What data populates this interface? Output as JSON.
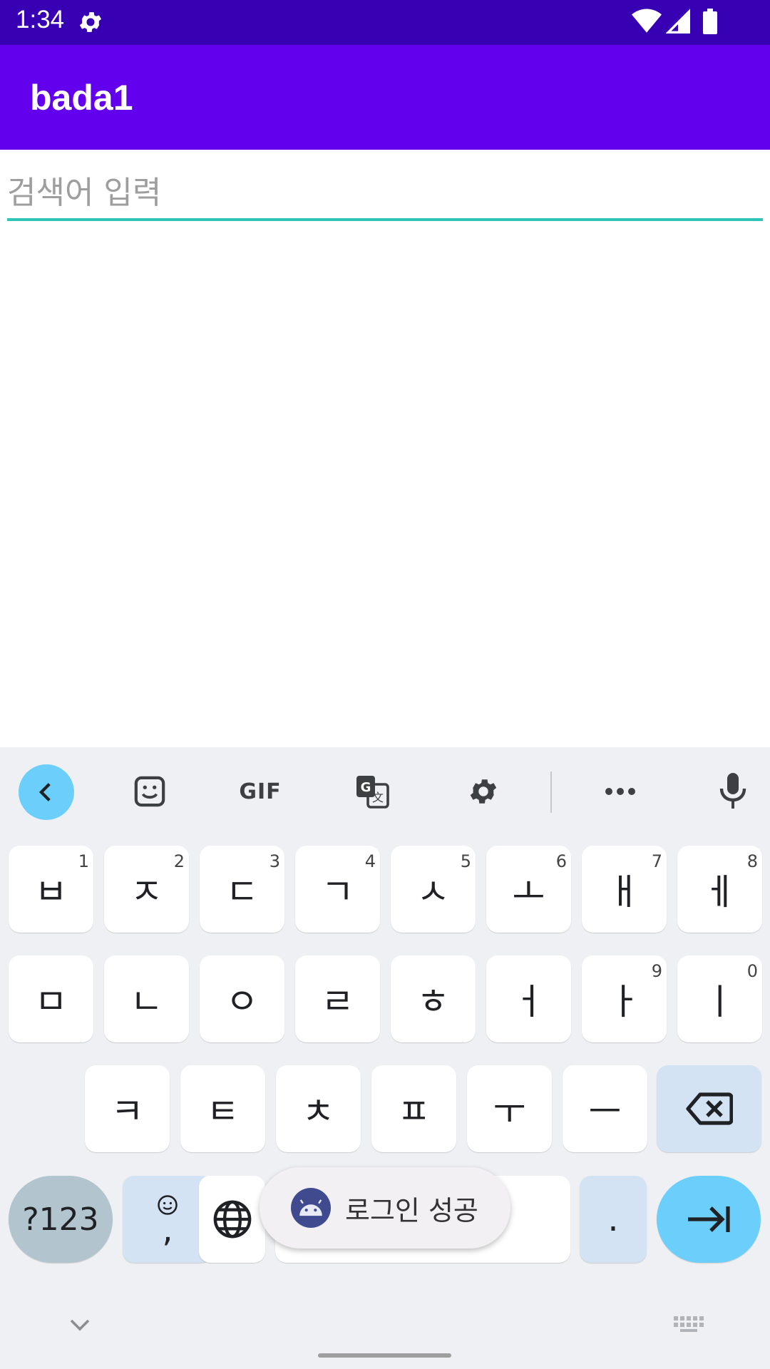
{
  "status_bar": {
    "time": "1:34"
  },
  "app_bar": {
    "title": "bada1"
  },
  "search": {
    "placeholder": "검색어 입력",
    "value": ""
  },
  "keyboard": {
    "toolbar": [
      "back-icon",
      "sticker-icon",
      "gif-icon",
      "translate-icon",
      "settings-icon",
      "more-icon",
      "mic-icon"
    ],
    "gif_label": "GIF",
    "row1": [
      {
        "char": "ㅂ",
        "hint": "1"
      },
      {
        "char": "ㅈ",
        "hint": "2"
      },
      {
        "char": "ㄷ",
        "hint": "3"
      },
      {
        "char": "ㄱ",
        "hint": "4"
      },
      {
        "char": "ㅅ",
        "hint": "5"
      },
      {
        "char": "ㅗ",
        "hint": "6"
      },
      {
        "char": "ㅐ",
        "hint": "7"
      },
      {
        "char": "ㅔ",
        "hint": "8"
      }
    ],
    "row2": [
      {
        "char": "ㅁ",
        "hint": ""
      },
      {
        "char": "ㄴ",
        "hint": ""
      },
      {
        "char": "ㅇ",
        "hint": ""
      },
      {
        "char": "ㄹ",
        "hint": ""
      },
      {
        "char": "ㅎ",
        "hint": ""
      },
      {
        "char": "ㅓ",
        "hint": ""
      },
      {
        "char": "ㅏ",
        "hint": "9"
      },
      {
        "char": "ㅣ",
        "hint": "0"
      }
    ],
    "row3": [
      "ㅋ",
      "ㅌ",
      "ㅊ",
      "ㅍ",
      "ㅜ",
      "ㅡ"
    ],
    "symbols_label": "?123",
    "emoji_comma_label": ",",
    "period_label": "."
  },
  "toast": {
    "text": "로그인 성공"
  },
  "colors": {
    "status_bar": "#3700b3",
    "app_bar": "#6200ee",
    "accent": "#2ec4b6",
    "kb_accent": "#6ccffb"
  }
}
